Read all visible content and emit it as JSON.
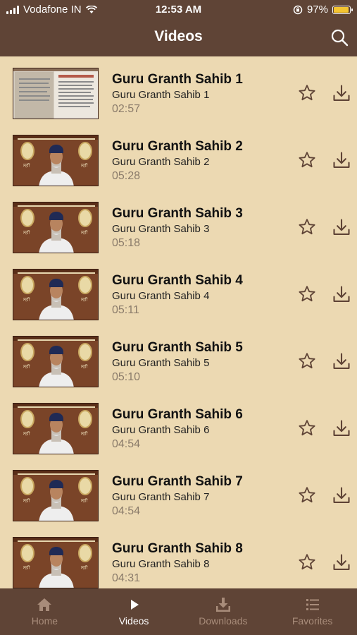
{
  "status": {
    "carrier": "Vodafone IN",
    "time": "12:53 AM",
    "battery": "97%",
    "battery_level": 0.97
  },
  "header": {
    "title": "Videos"
  },
  "videos": [
    {
      "title": "Guru Granth Sahib 1",
      "subtitle": "Guru Granth Sahib 1",
      "duration": "02:57",
      "thumb": "scripture"
    },
    {
      "title": "Guru Granth Sahib 2",
      "subtitle": "Guru Granth Sahib 2",
      "duration": "05:28",
      "thumb": "speaker"
    },
    {
      "title": "Guru Granth Sahib 3",
      "subtitle": "Guru Granth Sahib 3",
      "duration": "05:18",
      "thumb": "speaker"
    },
    {
      "title": "Guru Granth Sahib 4",
      "subtitle": "Guru Granth Sahib 4",
      "duration": "05:11",
      "thumb": "speaker"
    },
    {
      "title": "Guru Granth Sahib 5",
      "subtitle": "Guru Granth Sahib 5",
      "duration": "05:10",
      "thumb": "speaker"
    },
    {
      "title": "Guru Granth Sahib 6",
      "subtitle": "Guru Granth Sahib 6",
      "duration": "04:54",
      "thumb": "speaker"
    },
    {
      "title": "Guru Granth Sahib 7",
      "subtitle": "Guru Granth Sahib 7",
      "duration": "04:54",
      "thumb": "speaker"
    },
    {
      "title": "Guru Granth Sahib 8",
      "subtitle": "Guru Granth Sahib 8",
      "duration": "04:31",
      "thumb": "speaker"
    }
  ],
  "tabs": [
    {
      "label": "Home",
      "icon": "home-icon",
      "active": false
    },
    {
      "label": "Videos",
      "icon": "play-icon",
      "active": true
    },
    {
      "label": "Downloads",
      "icon": "download-tray-icon",
      "active": false
    },
    {
      "label": "Favorites",
      "icon": "list-icon",
      "active": false
    }
  ],
  "colors": {
    "bar": "#5f4436",
    "background": "#ecd9b2",
    "icon": "#5f4436",
    "tab_inactive": "#a88c7a",
    "tab_active": "#ffffff"
  }
}
